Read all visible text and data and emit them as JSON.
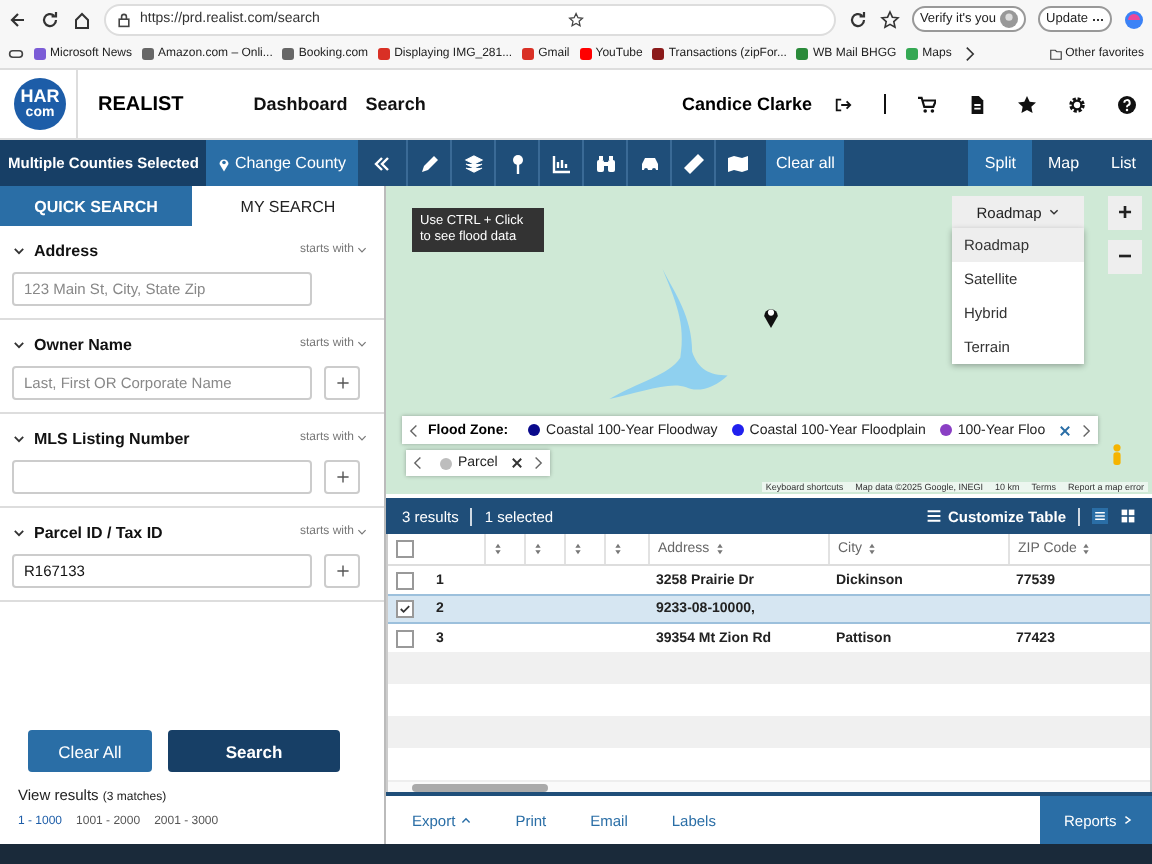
{
  "browser": {
    "url": "https://prd.realist.com/search",
    "verify": "Verify it's you",
    "update": "Update",
    "bookmarks": [
      {
        "label": "Microsoft News",
        "color": "#7b5cd6"
      },
      {
        "label": "Amazon.com – Onli...",
        "color": "#666666"
      },
      {
        "label": "Booking.com",
        "color": "#666666"
      },
      {
        "label": "Displaying IMG_281...",
        "color": "#d93025"
      },
      {
        "label": "Gmail",
        "color": "#d93025"
      },
      {
        "label": "YouTube",
        "color": "#ff0000"
      },
      {
        "label": "Transactions (zipFor...",
        "color": "#8b1a1a"
      },
      {
        "label": "WB Mail BHGG",
        "color": "#2a8a3a"
      },
      {
        "label": "Maps",
        "color": "#34a853"
      }
    ],
    "other_favorites": "Other favorites"
  },
  "header": {
    "logo_top": "HAR",
    "logo_bottom": "com",
    "product": "REALIST",
    "nav": [
      "Dashboard",
      "Search"
    ],
    "user": "Candice Clarke"
  },
  "county_bar": {
    "counties": "Multiple Counties Selected",
    "change": "Change County",
    "clear": "Clear all",
    "views": [
      {
        "label": "Split",
        "selected": true
      },
      {
        "label": "Map",
        "selected": false
      },
      {
        "label": "List",
        "selected": false
      }
    ]
  },
  "search_tabs": [
    {
      "label": "QUICK SEARCH",
      "selected": true
    },
    {
      "label": "MY SEARCH",
      "selected": false
    }
  ],
  "fields": [
    {
      "label": "Address",
      "match": "starts with",
      "placeholder": "123 Main St, City, State Zip",
      "add_button": false
    },
    {
      "label": "Owner Name",
      "match": "starts with",
      "placeholder": "Last, First OR Corporate Name",
      "add_button": true
    },
    {
      "label": "MLS Listing Number",
      "match": "starts with",
      "add_button": true
    },
    {
      "label": "Parcel ID / Tax ID",
      "match": "starts with",
      "value": "R167133",
      "add_button": true
    }
  ],
  "actions": {
    "clear": "Clear All",
    "search": "Search"
  },
  "view_results": {
    "label": "View results",
    "matches": "(3 matches)",
    "pages": [
      {
        "label": "1 - 1000",
        "selected": true
      },
      {
        "label": "1001 - 2000",
        "selected": false
      },
      {
        "label": "2001 - 3000",
        "selected": false
      }
    ]
  },
  "map": {
    "tooltip": "Use CTRL + Click to see flood data",
    "map_type": {
      "label": "Roadmap",
      "options": [
        {
          "label": "Roadmap",
          "selected": true
        },
        {
          "label": "Satellite",
          "selected": false
        },
        {
          "label": "Hybrid",
          "selected": false
        },
        {
          "label": "Terrain",
          "selected": false
        }
      ]
    },
    "zoom_in": "+",
    "zoom_out": "−",
    "flood_legend": {
      "title": "Flood Zone:",
      "items": [
        {
          "label": "Coastal 100-Year Floodway",
          "color": "#0a0a8c"
        },
        {
          "label": "Coastal 100-Year Floodplain",
          "color": "#2020ee"
        },
        {
          "label": "100-Year Floo",
          "color": "#8a3fc4"
        }
      ]
    },
    "parcel_chip": {
      "label": "Parcel",
      "color": "#bdbdbd"
    },
    "attribution": [
      "Keyboard shortcuts",
      "Map data ©2025 Google, INEGI",
      "10 km",
      "Terms",
      "Report a map error"
    ]
  },
  "results": {
    "count": "3 results",
    "selected": "1 selected",
    "customize": "Customize Table",
    "select_all_checked": false,
    "columns": [
      "Address",
      "City",
      "ZIP Code"
    ],
    "rows": [
      {
        "number": "1",
        "address": "3258 Prairie Dr",
        "city": "Dickinson",
        "zip": "77539",
        "selected": false
      },
      {
        "number": "2",
        "address": "9233-08-10000,",
        "selected": true
      },
      {
        "number": "3",
        "address": "39354 Mt Zion Rd",
        "city": "Pattison",
        "zip": "77423",
        "selected": false
      }
    ]
  },
  "footer": {
    "actions": [
      {
        "label": "Export",
        "menu": true
      },
      {
        "label": "Print",
        "menu": false
      },
      {
        "label": "Email",
        "menu": false
      },
      {
        "label": "Labels",
        "menu": false
      }
    ],
    "reports": "Reports"
  }
}
